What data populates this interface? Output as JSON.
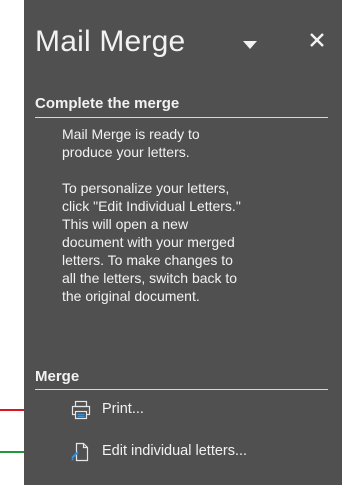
{
  "pane": {
    "title": "Mail Merge",
    "dropdown_icon": "triangle-down-icon",
    "close_icon": "close-icon"
  },
  "complete_section": {
    "heading": "Complete the merge",
    "intro_lines": [
      "Mail Merge is ready to",
      "produce your letters."
    ],
    "detail_lines": [
      "To personalize your letters,",
      "click \"Edit Individual Letters.\"",
      "This will open a new",
      "document with your merged",
      "letters. To make changes to",
      "all the letters, switch back to",
      "the original document."
    ]
  },
  "merge_section": {
    "heading": "Merge",
    "print_label": "Print...",
    "print_icon": "printer-icon",
    "edit_label": "Edit individual letters...",
    "edit_icon": "document-edit-icon"
  },
  "annotations": {
    "print_arrow_color": "#e0141e",
    "edit_arrow_color": "#1e9a3c"
  },
  "colors": {
    "pane_background": "#505050",
    "text": "#f2f2f2",
    "accent_blue": "#3a8fd9"
  }
}
